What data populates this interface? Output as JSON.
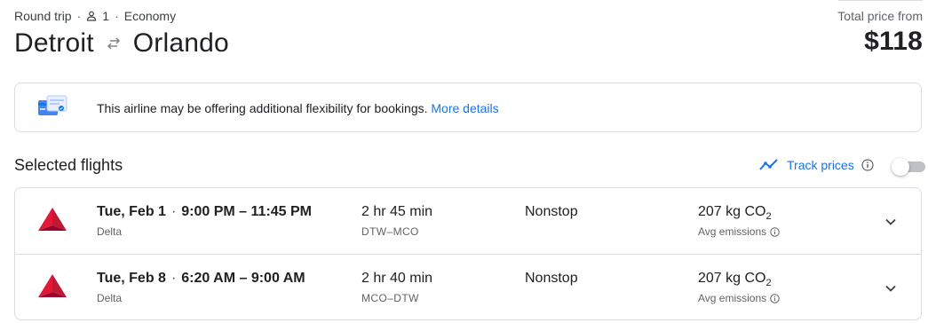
{
  "header": {
    "trip_type": "Round trip",
    "passengers": "1",
    "cabin": "Economy",
    "origin": "Detroit",
    "destination": "Orlando",
    "price_label": "Total price from",
    "price": "$118"
  },
  "notice": {
    "text": "This airline may be offering additional flexibility for bookings.",
    "link": "More details"
  },
  "selected": {
    "title": "Selected flights",
    "track_label": "Track prices"
  },
  "flights": [
    {
      "date": "Tue, Feb 1",
      "times": "9:00 PM – 11:45 PM",
      "airline": "Delta",
      "duration": "2 hr 45 min",
      "route": "DTW–MCO",
      "stops": "Nonstop",
      "co2_value": "207 kg CO",
      "co2_sub": "2",
      "emissions_label": "Avg emissions"
    },
    {
      "date": "Tue, Feb 8",
      "times": "6:20 AM – 9:00 AM",
      "airline": "Delta",
      "duration": "2 hr 40 min",
      "route": "MCO–DTW",
      "stops": "Nonstop",
      "co2_value": "207 kg CO",
      "co2_sub": "2",
      "emissions_label": "Avg emissions"
    }
  ],
  "colors": {
    "accent": "#1a73e8",
    "delta_red": "#c01933",
    "border": "#dadce0"
  },
  "icons": [
    "person-icon",
    "swap-arrows-icon",
    "flexible-booking-icon",
    "trend-icon",
    "info-icon",
    "delta-logo",
    "chevron-down-icon"
  ]
}
